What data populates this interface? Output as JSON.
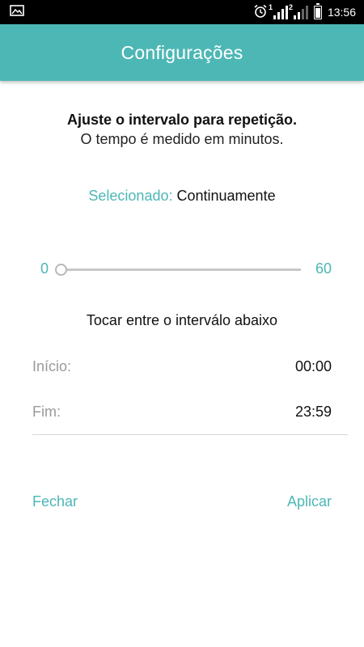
{
  "status_bar": {
    "time": "13:56",
    "sim1_label": "1",
    "sim2_label": "2",
    "icons": [
      "image-icon",
      "alarm-icon",
      "signal-icon",
      "signal-icon",
      "battery-icon"
    ]
  },
  "app_bar": {
    "title": "Configurações"
  },
  "instructions": {
    "line1": "Ajuste o intervalo para repetição.",
    "line2": "O tempo é medido em minutos."
  },
  "selection": {
    "label": "Selecionado:",
    "value": "Continuamente"
  },
  "slider": {
    "min_label": "0",
    "max_label": "60",
    "value": 0
  },
  "range": {
    "title": "Tocar entre o interválo abaixo",
    "start_label": "Início:",
    "start_value": "00:00",
    "end_label": "Fim:",
    "end_value": "23:59"
  },
  "actions": {
    "close_label": "Fechar",
    "apply_label": "Aplicar"
  },
  "colors": {
    "accent": "#4db7b5",
    "status_bar": "#000000",
    "muted_text": "#9a9a9a"
  }
}
